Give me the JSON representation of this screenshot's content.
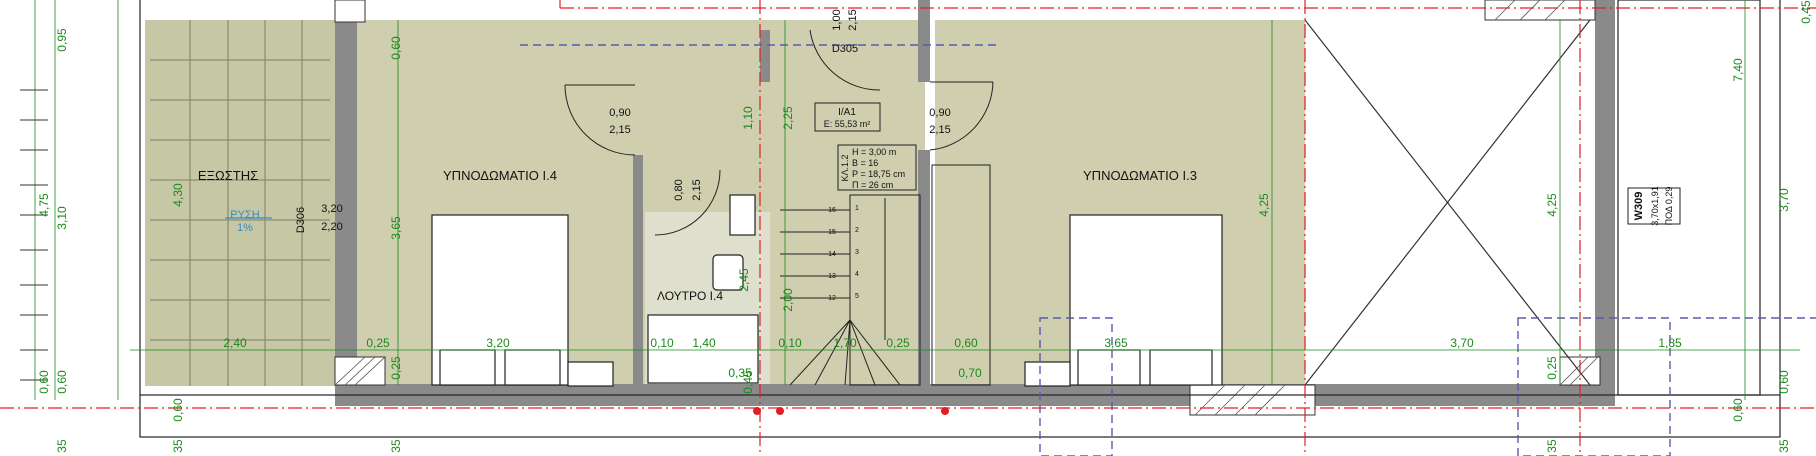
{
  "rooms": {
    "exostis": "ΕΞΩΣΤΗΣ",
    "bedroom_left": "ΥΠΝΟΔΩΜΑΤΙΟ Ι.4",
    "bedroom_right": "ΥΠΝΟΔΩΜΑΤΙΟ Ι.3",
    "bath": "ΛΟΥΤΡΟ Ι.4"
  },
  "slope": {
    "label": "ΡΥΣΗ",
    "value": "1%"
  },
  "unit": {
    "code": "Ι/Α1",
    "area": "Ε: 55,53 m²"
  },
  "stair": {
    "tag": "ΚΛ.1.2",
    "lines": [
      "Η = 3,00 m",
      "Β = 16",
      "Ρ = 18,75 cm",
      "Π = 26 cm"
    ],
    "steps": [
      "16",
      "15",
      "14",
      "13",
      "12",
      "1",
      "2",
      "3",
      "4",
      "5"
    ]
  },
  "doors": {
    "d305": "D305",
    "d306": "D306",
    "d306_dims": [
      "3,20",
      "2,20"
    ],
    "top_door": [
      "1,00",
      "2,15"
    ],
    "left_door": [
      "0,90",
      "2,15"
    ],
    "right_door": [
      "0,90",
      "2,15"
    ],
    "bath_door": [
      "0,80",
      "2,15"
    ]
  },
  "window": {
    "code": "W309",
    "dims": "3,70x1,91",
    "sill": "ΠΟΔ 0,29"
  },
  "dims_horizontal": [
    "2,40",
    "0,25",
    "3,20",
    "0,10",
    "1,40",
    "0,10",
    "1,70",
    "0,25",
    "0,60",
    "3,65",
    "3,70",
    "1,85",
    "0,35",
    "0,70"
  ],
  "dims_vertical": [
    "0,95",
    "4,75",
    "3,10",
    "0,60",
    "0,60",
    "0,60",
    "4,30",
    "0,60",
    "3,65",
    "0,25",
    "1,10",
    "2,25",
    "2,00",
    "2,45",
    "0,45",
    "4,25",
    "4,25",
    "0,25",
    "7,40",
    "3,70",
    "0,60",
    "0,60",
    "0,45"
  ],
  "bottom_numbers": [
    "35",
    "35",
    "35",
    "35",
    "35"
  ],
  "colors": {
    "floor": "#cfcfb0",
    "terrace": "#c6c7a4",
    "wall": "#8a8a8a",
    "dimension": "#1a8a1a",
    "axis": "#e02020",
    "hidden": "#5a5ab0"
  }
}
